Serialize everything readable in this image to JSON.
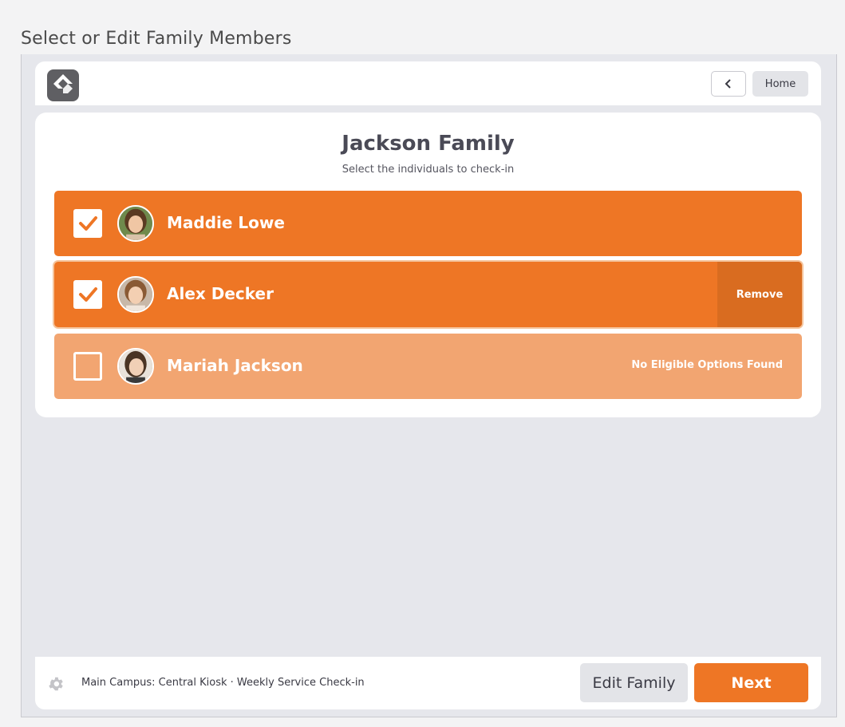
{
  "page_caption": "Select or Edit Family Members",
  "header": {
    "logo_icon": "rock-logo-icon",
    "back_icon": "chevron-left-icon",
    "home_label": "Home"
  },
  "family": {
    "title": "Jackson Family",
    "subtitle": "Select the individuals to check-in"
  },
  "people": [
    {
      "name": "Maddie Lowe",
      "selected": true,
      "action_label": "",
      "status": ""
    },
    {
      "name": "Alex Decker",
      "selected": true,
      "action_label": "Remove",
      "status": ""
    },
    {
      "name": "Mariah Jackson",
      "selected": false,
      "action_label": "",
      "status": "No Eligible Options Found"
    }
  ],
  "footer": {
    "settings_icon": "gear-icon",
    "kiosk_info": "Main Campus: Central Kiosk · Weekly Service Check-in",
    "edit_family_label": "Edit Family",
    "next_label": "Next"
  },
  "colors": {
    "accent": "#ee7625",
    "accent_light": "#f2a571",
    "remove_bg": "#d96c20",
    "frame_bg": "#e6e7ec"
  }
}
